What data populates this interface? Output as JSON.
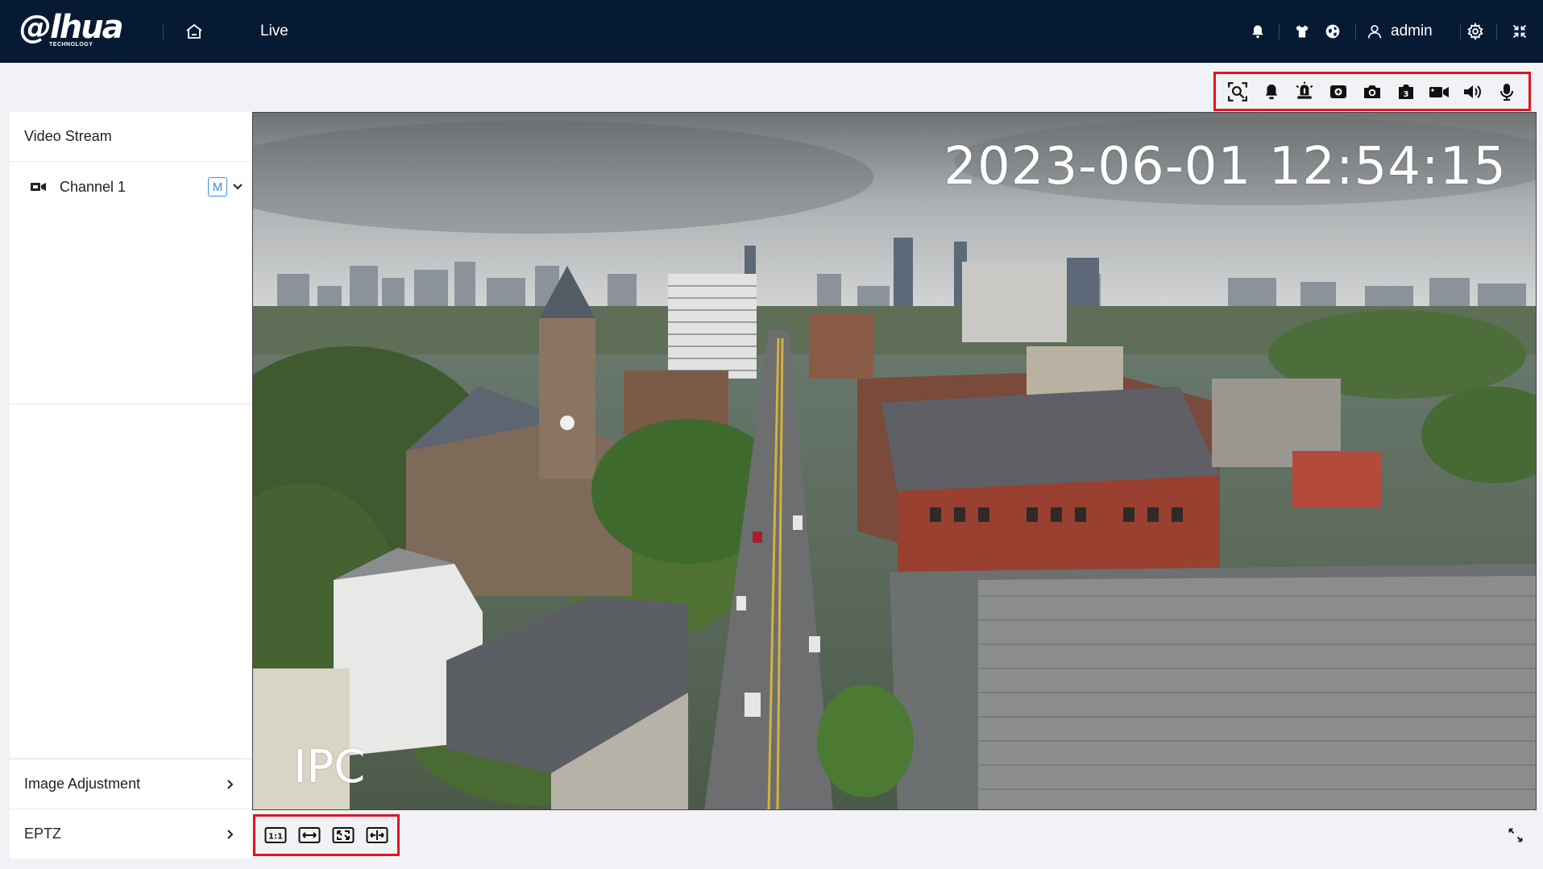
{
  "header": {
    "logo_text": "@lhua",
    "logo_sub": "TECHNOLOGY",
    "nav_live": "Live",
    "username": "admin",
    "icons": [
      "home-icon",
      "bell-icon",
      "shirt-icon",
      "globe-icon",
      "user-icon",
      "gear-icon",
      "collapse-icon"
    ]
  },
  "live_toolbar": {
    "icons": [
      "ai-overlay-icon",
      "alarm-icon",
      "alarm-out-icon",
      "zoom-in-icon",
      "snapshot-icon",
      "triple-snapshot-icon",
      "record-icon",
      "audio-icon",
      "talk-icon"
    ]
  },
  "sidebar": {
    "video_stream_label": "Video Stream",
    "channel_label": "Channel 1",
    "channel_badge": "M",
    "image_adjustment_label": "Image Adjustment",
    "eptz_label": "EPTZ"
  },
  "video": {
    "osd_time": "2023-06-01 12:54:15",
    "osd_channel_name": "IPC"
  },
  "bottom_toolbar": {
    "icons": [
      "original-size-icon",
      "fit-width-icon",
      "stretch-icon",
      "fit-window-icon"
    ],
    "fullscreen_icon": "fullscreen-icon"
  },
  "colors": {
    "topbar": "#061a33",
    "highlight_border": "#e3141e",
    "badge": "#3d8ef0"
  }
}
